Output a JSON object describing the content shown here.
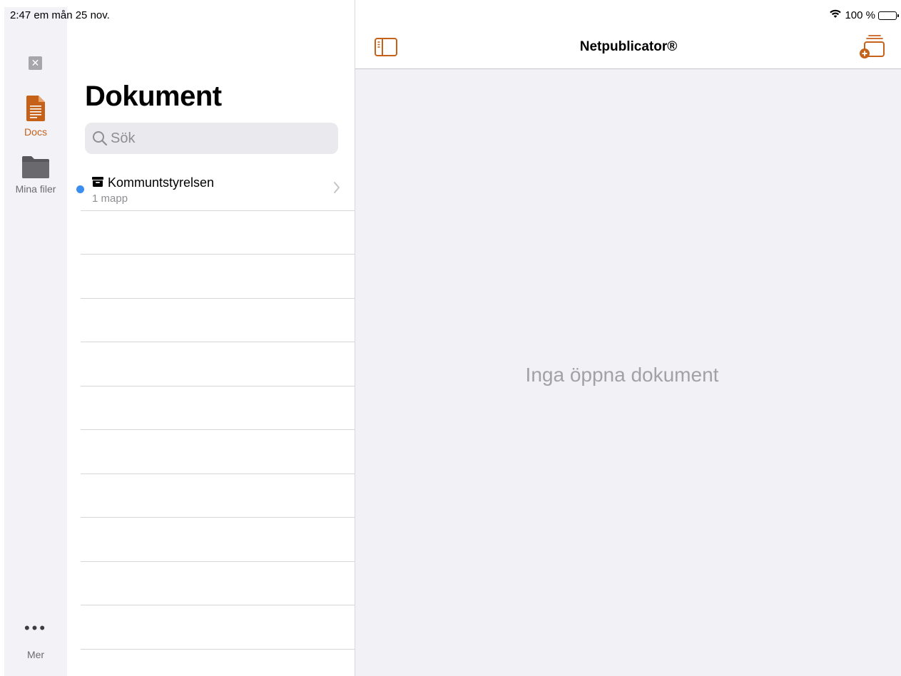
{
  "status_bar": {
    "time_date": "2:47 em   mån 25 nov.",
    "battery_text": "100 %",
    "battery_level": 1.0
  },
  "rail": {
    "close_icon": "close-icon",
    "items": [
      {
        "label": "Docs",
        "icon": "document-icon",
        "active": true
      },
      {
        "label": "Mina filer",
        "icon": "folder-icon",
        "active": false
      }
    ],
    "more": {
      "label": "Mer",
      "icon": "ellipsis-icon"
    }
  },
  "list_pane": {
    "title": "Dokument",
    "search": {
      "placeholder": "Sök",
      "value": ""
    },
    "items": [
      {
        "title": "Kommuntstyrelsen",
        "subtitle": "1 mapp",
        "icon": "archive-box-icon",
        "unread": true
      }
    ]
  },
  "detail": {
    "title": "Netpublicator®",
    "empty_message": "Inga öppna dokument"
  },
  "colors": {
    "accent": "#c6611a",
    "unread_dot": "#3a8ef0",
    "detail_bg": "#f2f1f6",
    "rail_bg": "#f2f2f7"
  }
}
